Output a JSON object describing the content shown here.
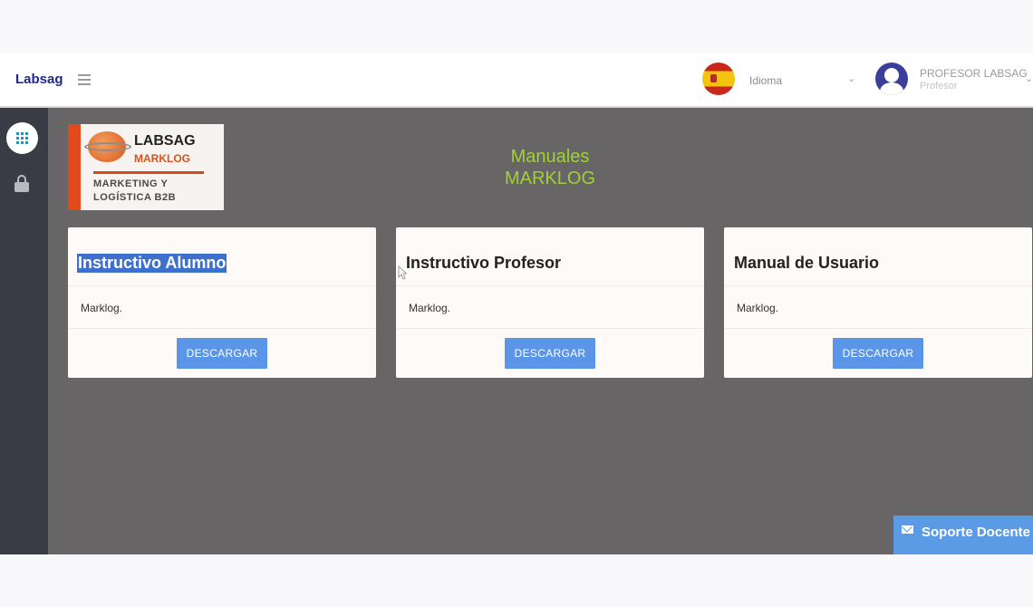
{
  "navbar": {
    "brand": "Labsag",
    "language_label": "Idioma",
    "user_name": "PROFESOR LABSAG",
    "user_role": "Profesor"
  },
  "logo": {
    "title": "LABSAG",
    "subtitle": "MARKLOG",
    "tagline_line1": "MARKETING Y",
    "tagline_line2": "LOGÍSTICA B2B"
  },
  "page": {
    "title_line1": "Manuales",
    "title_line2": "MARKLOG"
  },
  "cards": [
    {
      "title": "Instructivo Alumno",
      "description": "Marklog.",
      "button": "DESCARGAR",
      "title_selected": true
    },
    {
      "title": "Instructivo Profesor",
      "description": "Marklog.",
      "button": "DESCARGAR"
    },
    {
      "title": "Manual de Usuario",
      "description": "Marklog.",
      "button": "DESCARGAR"
    }
  ],
  "support": {
    "label": "Soporte Docente"
  },
  "colors": {
    "brand": "#1d2a8c",
    "title_green": "#9fd236",
    "button_blue": "#5b95e8",
    "sidebar": "#393c45",
    "overlay": "#686566"
  },
  "icons": [
    "menu-icon",
    "spain-flag-icon",
    "user-avatar-icon",
    "apps-grid-icon",
    "lock-icon",
    "mail-icon"
  ]
}
